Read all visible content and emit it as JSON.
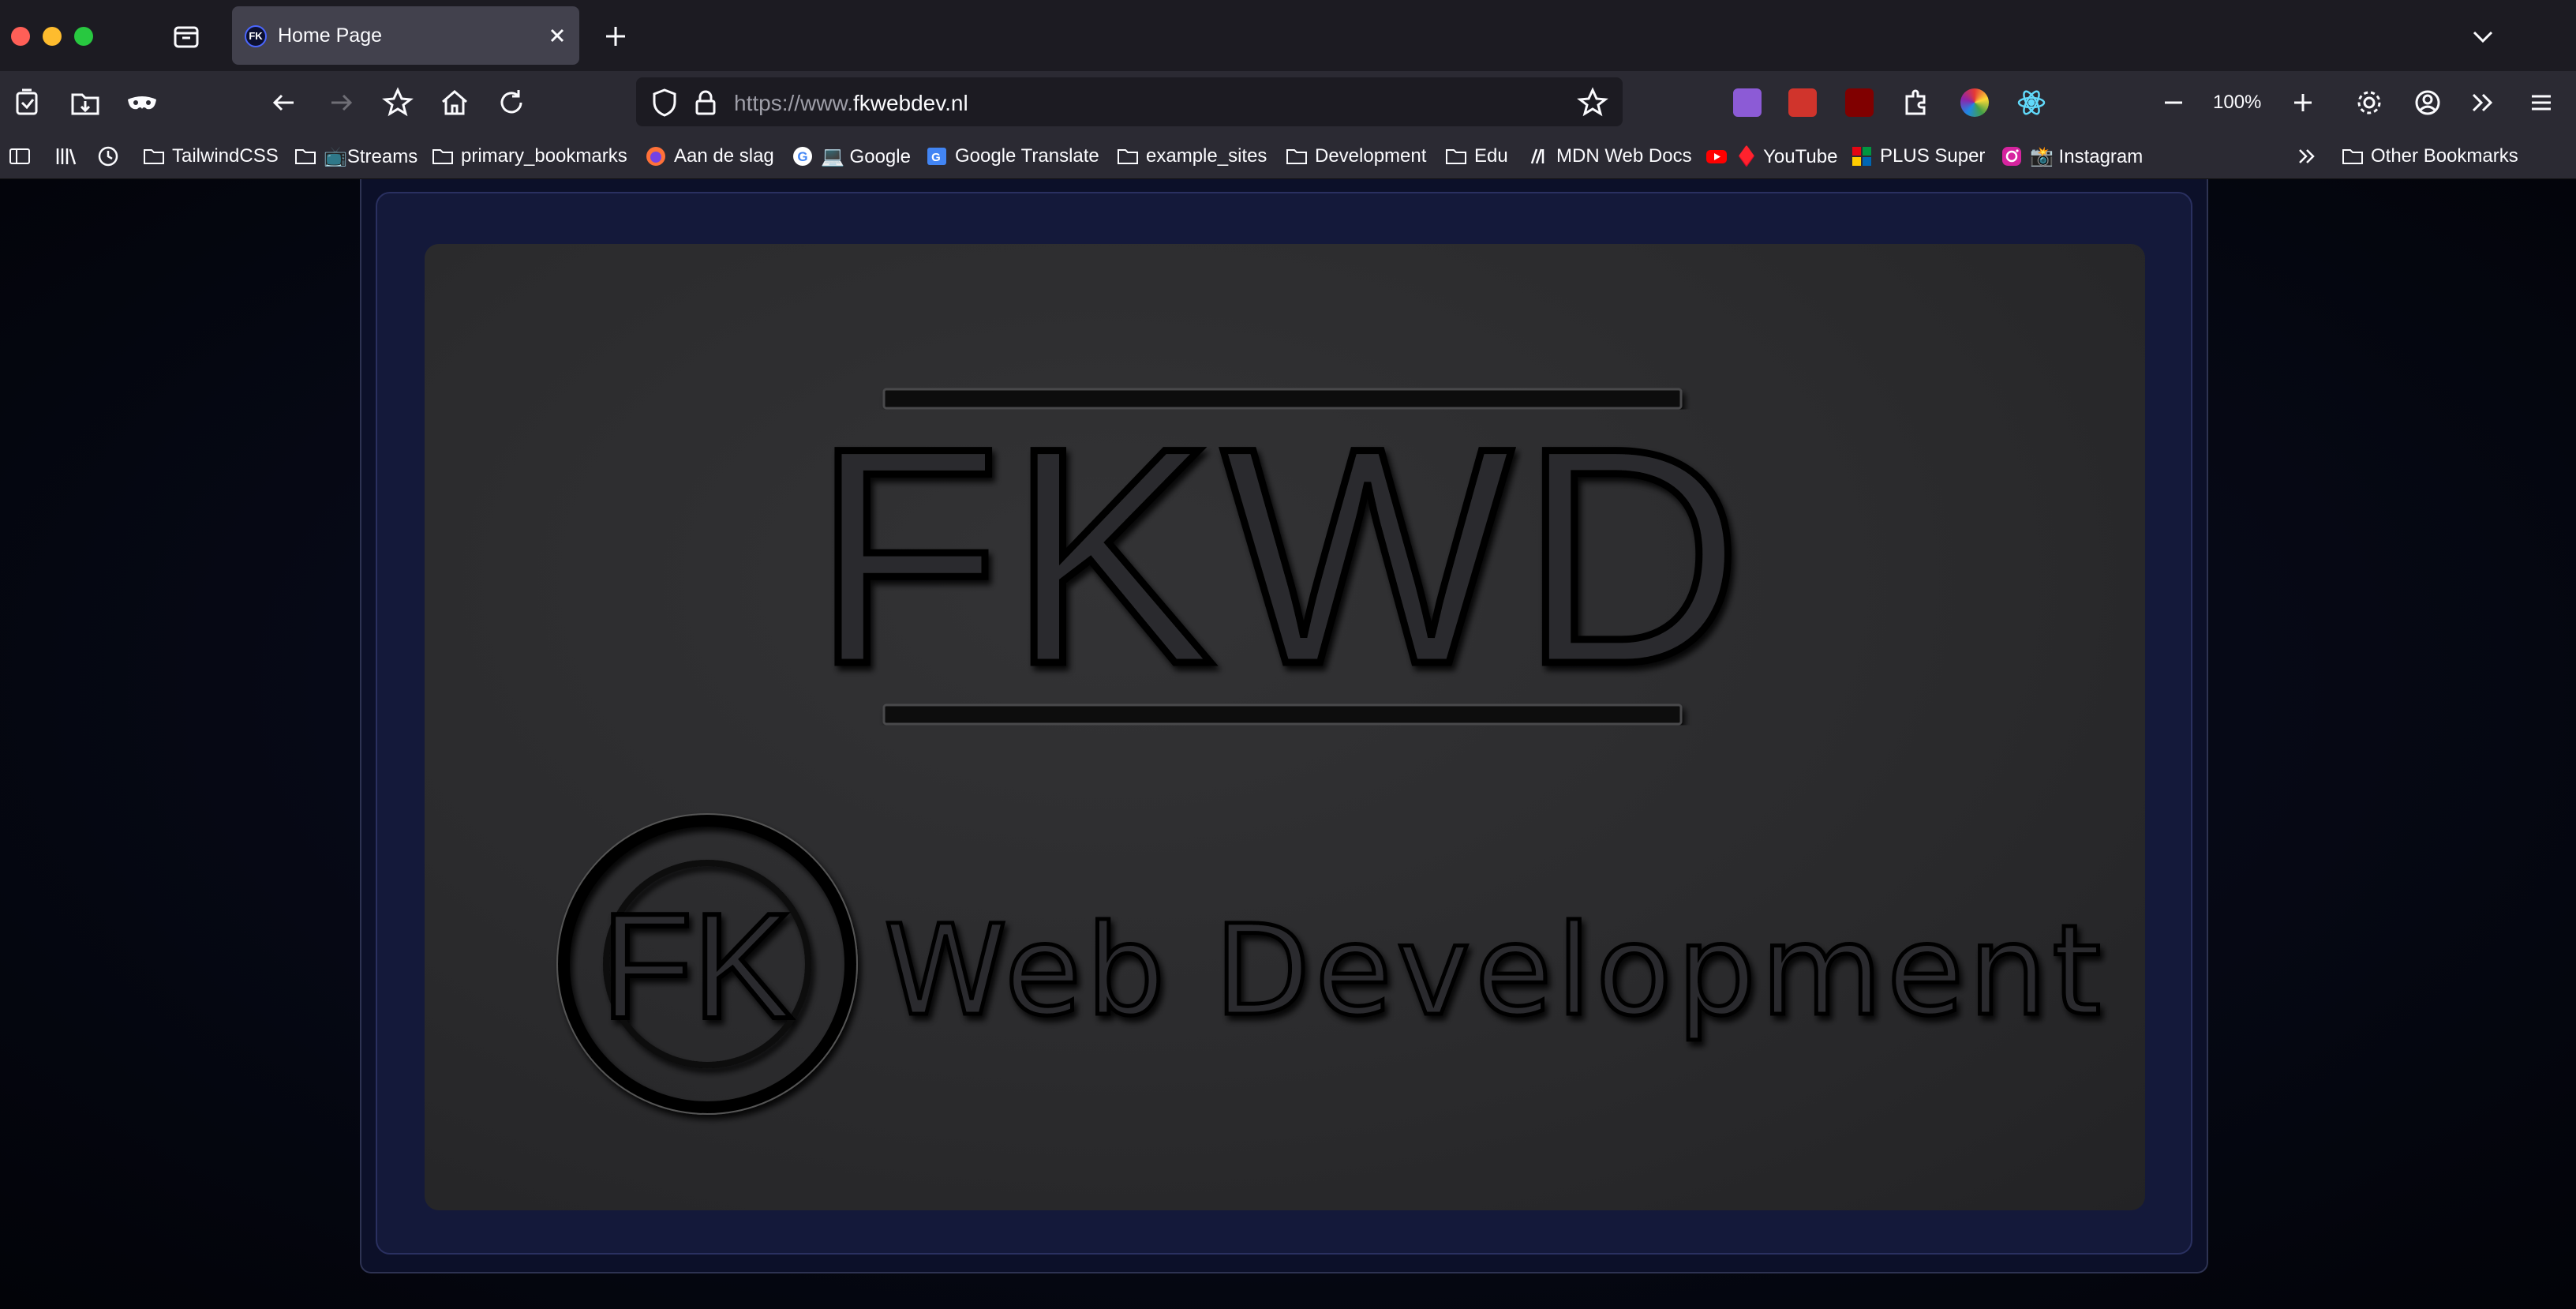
{
  "window": {
    "tab_title": "Home Page",
    "tab_favicon_text": "FK"
  },
  "toolbar": {
    "url_prefix": "https://www.",
    "url_domain": "fkwebdev.nl",
    "zoom": "100%"
  },
  "bookmarks": [
    {
      "label": "TailwindCSS",
      "icon": "folder-icon"
    },
    {
      "label": "📺Streams",
      "icon": "folder-icon"
    },
    {
      "label": "primary_bookmarks",
      "icon": "folder-icon"
    },
    {
      "label": "Aan de slag",
      "icon": "firefox-icon"
    },
    {
      "label": "💻 Google",
      "icon": "google-icon"
    },
    {
      "label": "Google Translate",
      "icon": "translate-icon"
    },
    {
      "label": "example_sites",
      "icon": "folder-icon"
    },
    {
      "label": "Development",
      "icon": "folder-icon"
    },
    {
      "label": "Edu",
      "icon": "folder-icon"
    },
    {
      "label": "MDN Web Docs",
      "icon": "mdn-icon"
    },
    {
      "label": "♦️ YouTube",
      "icon": "youtube-icon"
    },
    {
      "label": "PLUS Super",
      "icon": "plus-icon"
    },
    {
      "label": "📸 Instagram",
      "icon": "instagram-icon"
    }
  ],
  "other_bookmarks": "Other Bookmarks",
  "page": {
    "logo_title": "FKWD",
    "emblem_text": "FK",
    "tagline": "Web Development"
  },
  "colors": {
    "accent_blue": "#4a66ff",
    "panel": "#2e2e30",
    "frame": "#14193a"
  }
}
